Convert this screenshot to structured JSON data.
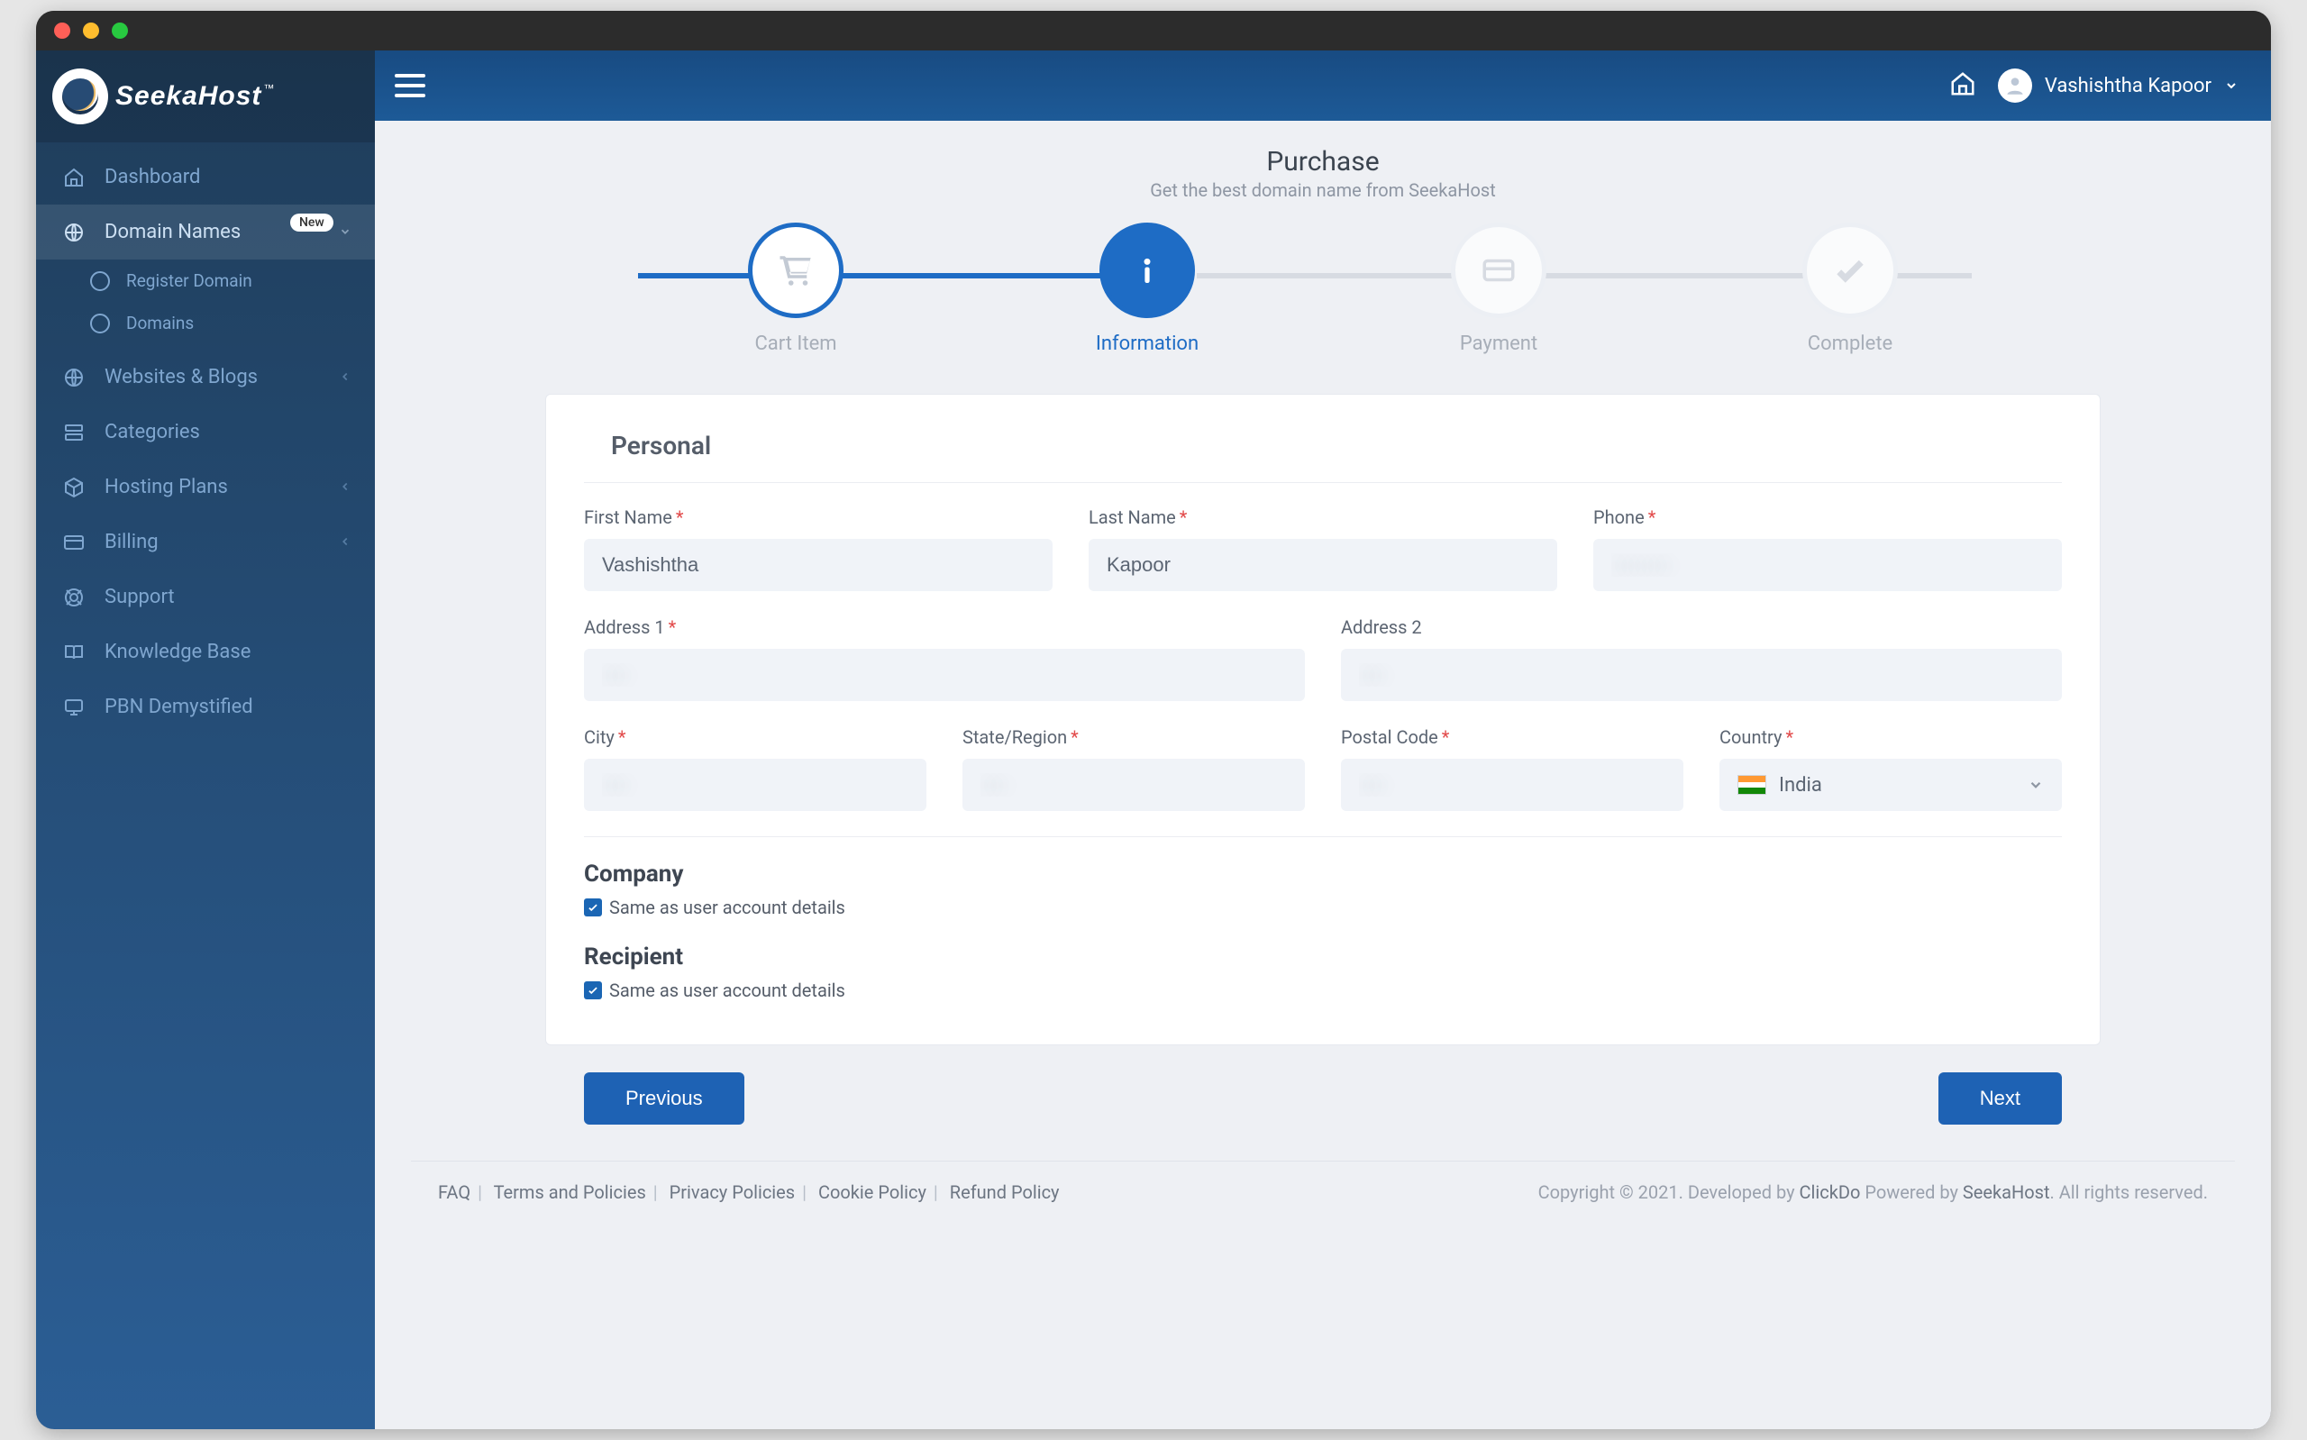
{
  "brand": {
    "name": "SeekaHost",
    "tm": "™"
  },
  "header": {
    "user_name": "Vashishtha Kapoor"
  },
  "sidebar": {
    "items": [
      {
        "label": "Dashboard",
        "icon": "home"
      },
      {
        "label": "Domain Names",
        "icon": "globe",
        "badge": "New",
        "expandable": true,
        "active": true,
        "children": [
          {
            "label": "Register Domain"
          },
          {
            "label": "Domains"
          }
        ]
      },
      {
        "label": "Websites & Blogs",
        "icon": "globe",
        "expandable": true
      },
      {
        "label": "Categories",
        "icon": "list"
      },
      {
        "label": "Hosting Plans",
        "icon": "box",
        "expandable": true
      },
      {
        "label": "Billing",
        "icon": "card",
        "expandable": true
      },
      {
        "label": "Support",
        "icon": "lifebuoy"
      },
      {
        "label": "Knowledge Base",
        "icon": "book"
      },
      {
        "label": "PBN Demystified",
        "icon": "monitor"
      }
    ]
  },
  "page": {
    "title": "Purchase",
    "subtitle": "Get the best domain name from SeekaHost"
  },
  "stepper": [
    {
      "label": "Cart Item",
      "icon": "cart",
      "state": "done"
    },
    {
      "label": "Information",
      "icon": "info",
      "state": "active"
    },
    {
      "label": "Payment",
      "icon": "card",
      "state": "pending"
    },
    {
      "label": "Complete",
      "icon": "check",
      "state": "pending"
    }
  ],
  "form": {
    "section_personal": "Personal",
    "first_name": {
      "label": "First Name",
      "required": true,
      "value": "Vashishtha"
    },
    "last_name": {
      "label": "Last Name",
      "required": true,
      "value": "Kapoor"
    },
    "phone": {
      "label": "Phone",
      "required": true,
      "value": "·········"
    },
    "address1": {
      "label": "Address 1",
      "required": true,
      "value": "····"
    },
    "address2": {
      "label": "Address 2",
      "required": false,
      "value": "····"
    },
    "city": {
      "label": "City",
      "required": true,
      "value": "····"
    },
    "state": {
      "label": "State/Region",
      "required": true,
      "value": "····"
    },
    "postal": {
      "label": "Postal Code",
      "required": true,
      "value": "····"
    },
    "country": {
      "label": "Country",
      "required": true,
      "value": "India"
    },
    "section_company": "Company",
    "company_same_label": "Same as user account details",
    "company_same_checked": true,
    "section_recipient": "Recipient",
    "recipient_same_label": "Same as user account details",
    "recipient_same_checked": true
  },
  "actions": {
    "previous": "Previous",
    "next": "Next"
  },
  "footer": {
    "links": [
      "FAQ",
      "Terms and Policies",
      "Privacy Policies",
      "Cookie Policy",
      "Refund Policy"
    ],
    "copyright_prefix": "Copyright © 2021. Developed by ",
    "dev": "ClickDo",
    "powered_by_prefix": " Powered by ",
    "powered_by": "SeekaHost",
    "suffix": ". All rights reserved."
  }
}
